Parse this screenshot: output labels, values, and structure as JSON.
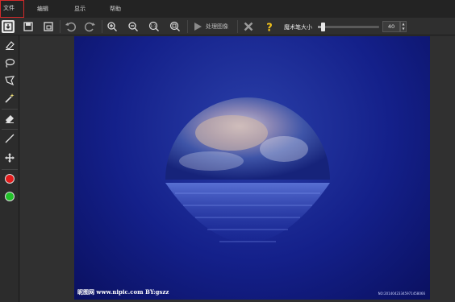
{
  "menubar": {
    "file": "文件",
    "edit": "编辑",
    "view": "显示",
    "help": "帮助"
  },
  "toolbar": {
    "icons": [
      "import-icon",
      "save-icon",
      "save-as-icon",
      "undo-icon",
      "redo-icon",
      "zoom-in-icon",
      "zoom-out-icon",
      "actual-size-icon",
      "fit-icon"
    ],
    "process_label": "处理图像",
    "brush_size_label": "魔术笔大小",
    "brush_size_value": "40",
    "brush_size_fraction": 0.08
  },
  "sidebar": {
    "tools": [
      "eraser-brush-icon",
      "lasso-icon",
      "polygon-lasso-icon",
      "magic-wand-icon",
      "eraser-icon",
      "line-icon",
      "move-icon"
    ],
    "foreground_color": "#e21b1b",
    "background_color": "#22c12a"
  },
  "image": {
    "watermark_left": "昵图网 www.nipic.com   BY:gszz",
    "watermark_right": "NO:20140423345971458066"
  },
  "colors": {
    "menu_highlight": "#d42a2a",
    "accent_yellow": "#f2c21b"
  }
}
